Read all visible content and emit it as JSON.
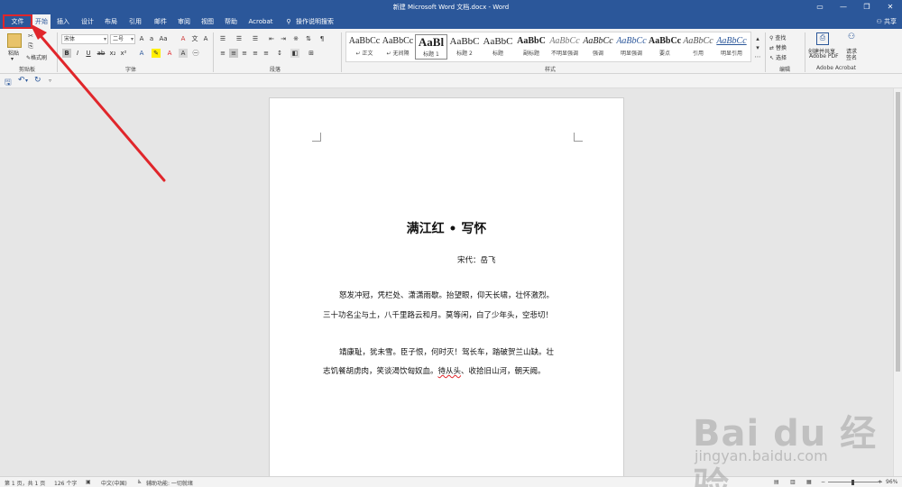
{
  "window": {
    "title": "新建 Microsoft Word 文档.docx - Word",
    "minimize": "—",
    "restore": "❐",
    "close": "✕"
  },
  "tabs": [
    {
      "label": "文件"
    },
    {
      "label": "开始"
    },
    {
      "label": "插入"
    },
    {
      "label": "设计"
    },
    {
      "label": "布局"
    },
    {
      "label": "引用"
    },
    {
      "label": "邮件"
    },
    {
      "label": "审阅"
    },
    {
      "label": "视图"
    },
    {
      "label": "帮助"
    },
    {
      "label": "Acrobat"
    }
  ],
  "tell_me": "操作说明搜索",
  "share": "共享",
  "ribbon": {
    "clipboard": {
      "paste": "粘贴",
      "format_painter": "格式刷",
      "label": "剪贴板"
    },
    "font": {
      "name": "宋体",
      "size": "二号",
      "label": "字体"
    },
    "paragraph": {
      "label": "段落"
    },
    "styles": {
      "label": "样式",
      "items": [
        {
          "sample": "AaBbCc",
          "name": "↵ 正文"
        },
        {
          "sample": "AaBbCc",
          "name": "↵ 无间隔"
        },
        {
          "sample": "AaBl",
          "name": "标题 1"
        },
        {
          "sample": "AaBbC",
          "name": "标题 2"
        },
        {
          "sample": "AaBbC",
          "name": "标题"
        },
        {
          "sample": "AaBbC",
          "name": "副标题"
        },
        {
          "sample": "AaBbCc",
          "name": "不明显强调"
        },
        {
          "sample": "AaBbCc",
          "name": "强调"
        },
        {
          "sample": "AaBbCc",
          "name": "明显强调"
        },
        {
          "sample": "AaBbCc",
          "name": "要点"
        },
        {
          "sample": "AaBbCc",
          "name": "引用"
        },
        {
          "sample": "AaBbCc",
          "name": "明显引用"
        }
      ]
    },
    "editing": {
      "find": "查找",
      "replace": "替换",
      "select": "选择",
      "label": "编辑"
    },
    "acrobat": {
      "create": "创建并共享",
      "create2": "Adobe PDF",
      "request": "请求",
      "request2": "签名",
      "label": "Adobe Acrobat"
    }
  },
  "document": {
    "title": "满江红 • 写怀",
    "author": "宋代：岳飞",
    "lines": [
      "怒发冲冠，凭栏处、潇潇雨歇。抬望眼，仰天长啸，壮怀激烈。",
      "三十功名尘与土，八千里路云和月。莫等闲，白了少年头，空悲切！",
      "靖康耻，犹未雪。臣子恨，何时灭！驾长车，踏破贺兰山缺。壮",
      "志饥餐胡虏肉，笑谈渴饮匈奴血。",
      "待从头",
      "、收拾旧山河，朝天阙。"
    ]
  },
  "status": {
    "page": "第 1 页，共 1 页",
    "words": "126 个字",
    "lang": "中文(中国)",
    "accessibility": "辅助功能: 一切就绪",
    "zoom": "96%"
  },
  "watermark": {
    "main": "Bai du 经验",
    "sub": "jingyan.baidu.com"
  },
  "colors": {
    "brand": "#2b579a",
    "highlight": "#e0262b"
  }
}
